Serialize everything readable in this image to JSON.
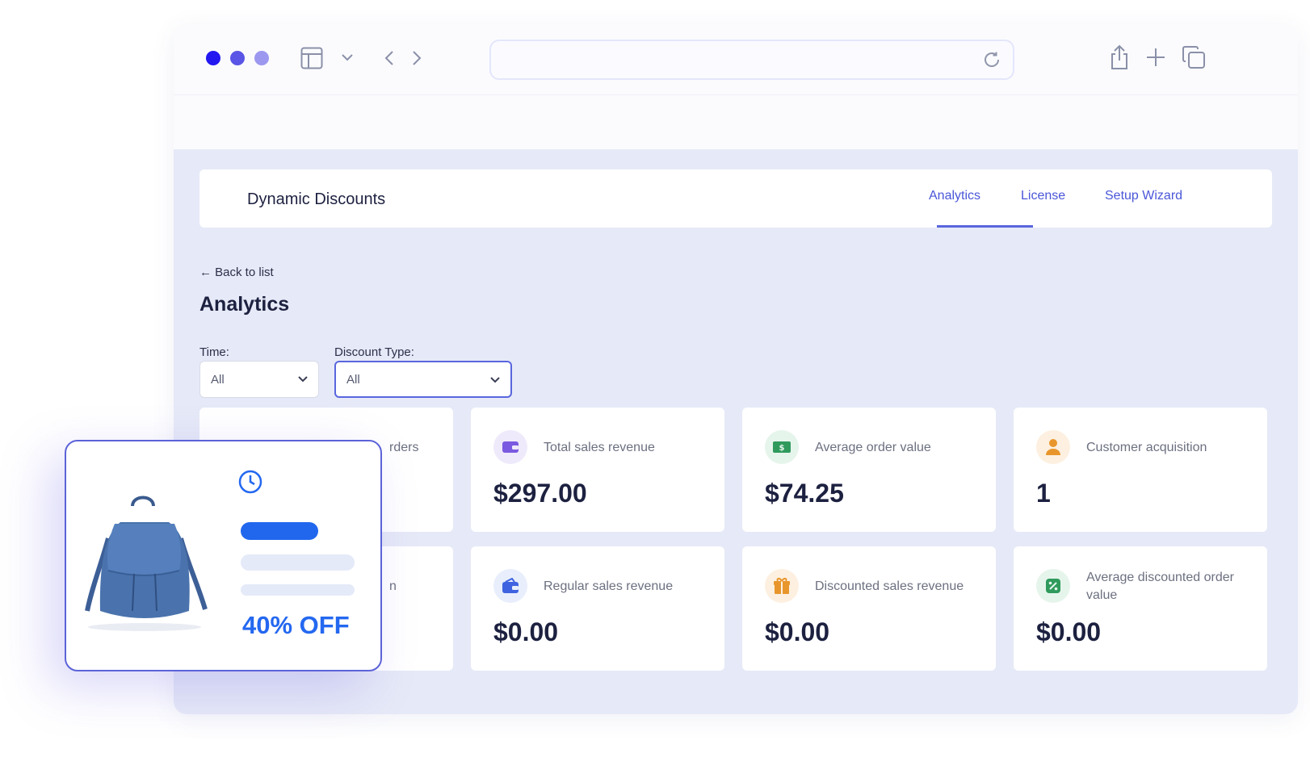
{
  "browser": {
    "dot_colors": [
      "#2318f0",
      "#5a55e6",
      "#9c98f0"
    ]
  },
  "app": {
    "title": "Dynamic Discounts",
    "tabs": [
      {
        "label": "Analytics",
        "active": true
      },
      {
        "label": "License",
        "active": false
      },
      {
        "label": "Setup Wizard",
        "active": false
      }
    ],
    "back_link": "← Back to list",
    "page_title": "Analytics",
    "filters": {
      "time": {
        "label": "Time:",
        "value": "All"
      },
      "discount_type": {
        "label": "Discount Type:",
        "value": "All"
      }
    },
    "cards": [
      {
        "label": "rders",
        "value": "",
        "icon": "orders-icon"
      },
      {
        "label": "Total sales revenue",
        "value": "$297.00",
        "icon": "wallet-icon",
        "color": "#7a5ae0"
      },
      {
        "label": "Average order value",
        "value": "$74.25",
        "icon": "dollar-bill-icon",
        "color": "#2f9a5c"
      },
      {
        "label": "Customer acquisition",
        "value": "1",
        "icon": "user-icon",
        "color": "#e8962c"
      },
      {
        "label": "n",
        "value": "",
        "icon": "hidden-icon"
      },
      {
        "label": "Regular sales revenue",
        "value": "$0.00",
        "icon": "purse-icon",
        "color": "#3f63e0"
      },
      {
        "label": "Discounted sales revenue",
        "value": "$0.00",
        "icon": "gift-icon",
        "color": "#e8962c"
      },
      {
        "label": "Average discounted order value",
        "value": "$0.00",
        "icon": "percent-icon",
        "color": "#2f9a5c"
      }
    ],
    "accent": "#5966de"
  },
  "promo": {
    "discount_text": "40% OFF",
    "accent": "#2468f0"
  }
}
